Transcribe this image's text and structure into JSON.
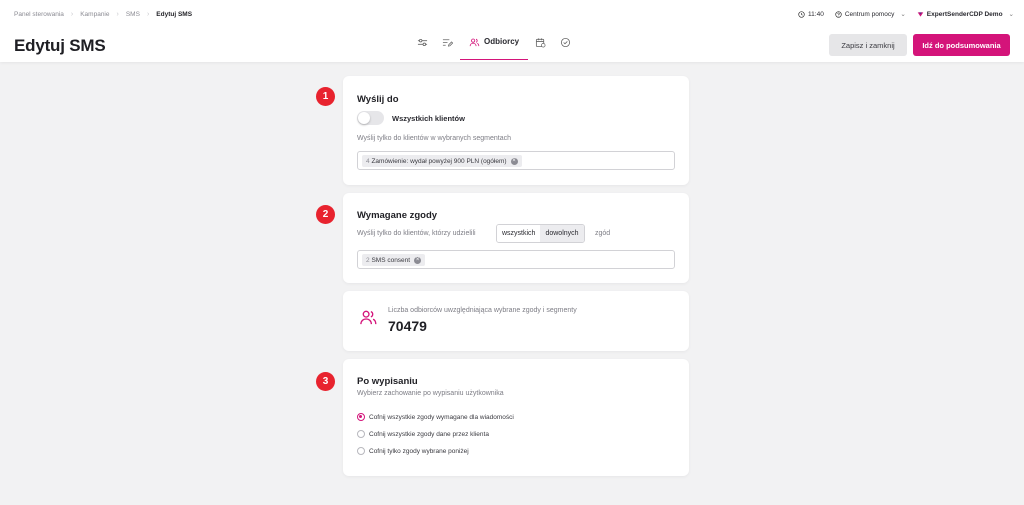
{
  "breadcrumb": [
    "Panel sterowania",
    "Kampanie",
    "SMS",
    "Edytuj SMS"
  ],
  "header": {
    "time": "11:40",
    "help": "Centrum pomocy",
    "account": "ExpertSenderCDP Demo",
    "title": "Edytuj SMS",
    "active_tab": "Odbiorcy",
    "save_label": "Zapisz i zamknij",
    "next_label": "Idź do podsumowania"
  },
  "colors": {
    "accent": "#d4147a",
    "step": "#e8232e"
  },
  "send_to": {
    "step": "1",
    "title": "Wyślij do",
    "toggle_label": "Wszystkich klientów",
    "toggle_on": false,
    "hint": "Wyślij tylko do klientów w wybranych segmentach",
    "tag_count": "4",
    "tag_label": "Zamówienie: wydał powyżej 900 PLN (ogółem)"
  },
  "consents": {
    "step": "2",
    "title": "Wymagane zgody",
    "text_before": "Wyślij tylko do klientów, którzy udzielili",
    "option_all": "wszystkich",
    "option_any": "dowolnych",
    "selected": "dowolnych",
    "text_after": "zgód",
    "tag_count": "2",
    "tag_label": "SMS consent"
  },
  "recipients": {
    "label": "Liczba odbiorców uwzględniająca wybrane zgody i segmenty",
    "value": "70479"
  },
  "unsubscribe": {
    "step": "3",
    "title": "Po wypisaniu",
    "subtitle": "Wybierz zachowanie po wypisaniu użytkownika",
    "options": [
      "Cofnij wszystkie zgody wymagane dla wiadomości",
      "Cofnij wszystkie zgody dane przez klienta",
      "Cofnij tylko zgody wybrane poniżej"
    ],
    "selected_index": 0
  }
}
